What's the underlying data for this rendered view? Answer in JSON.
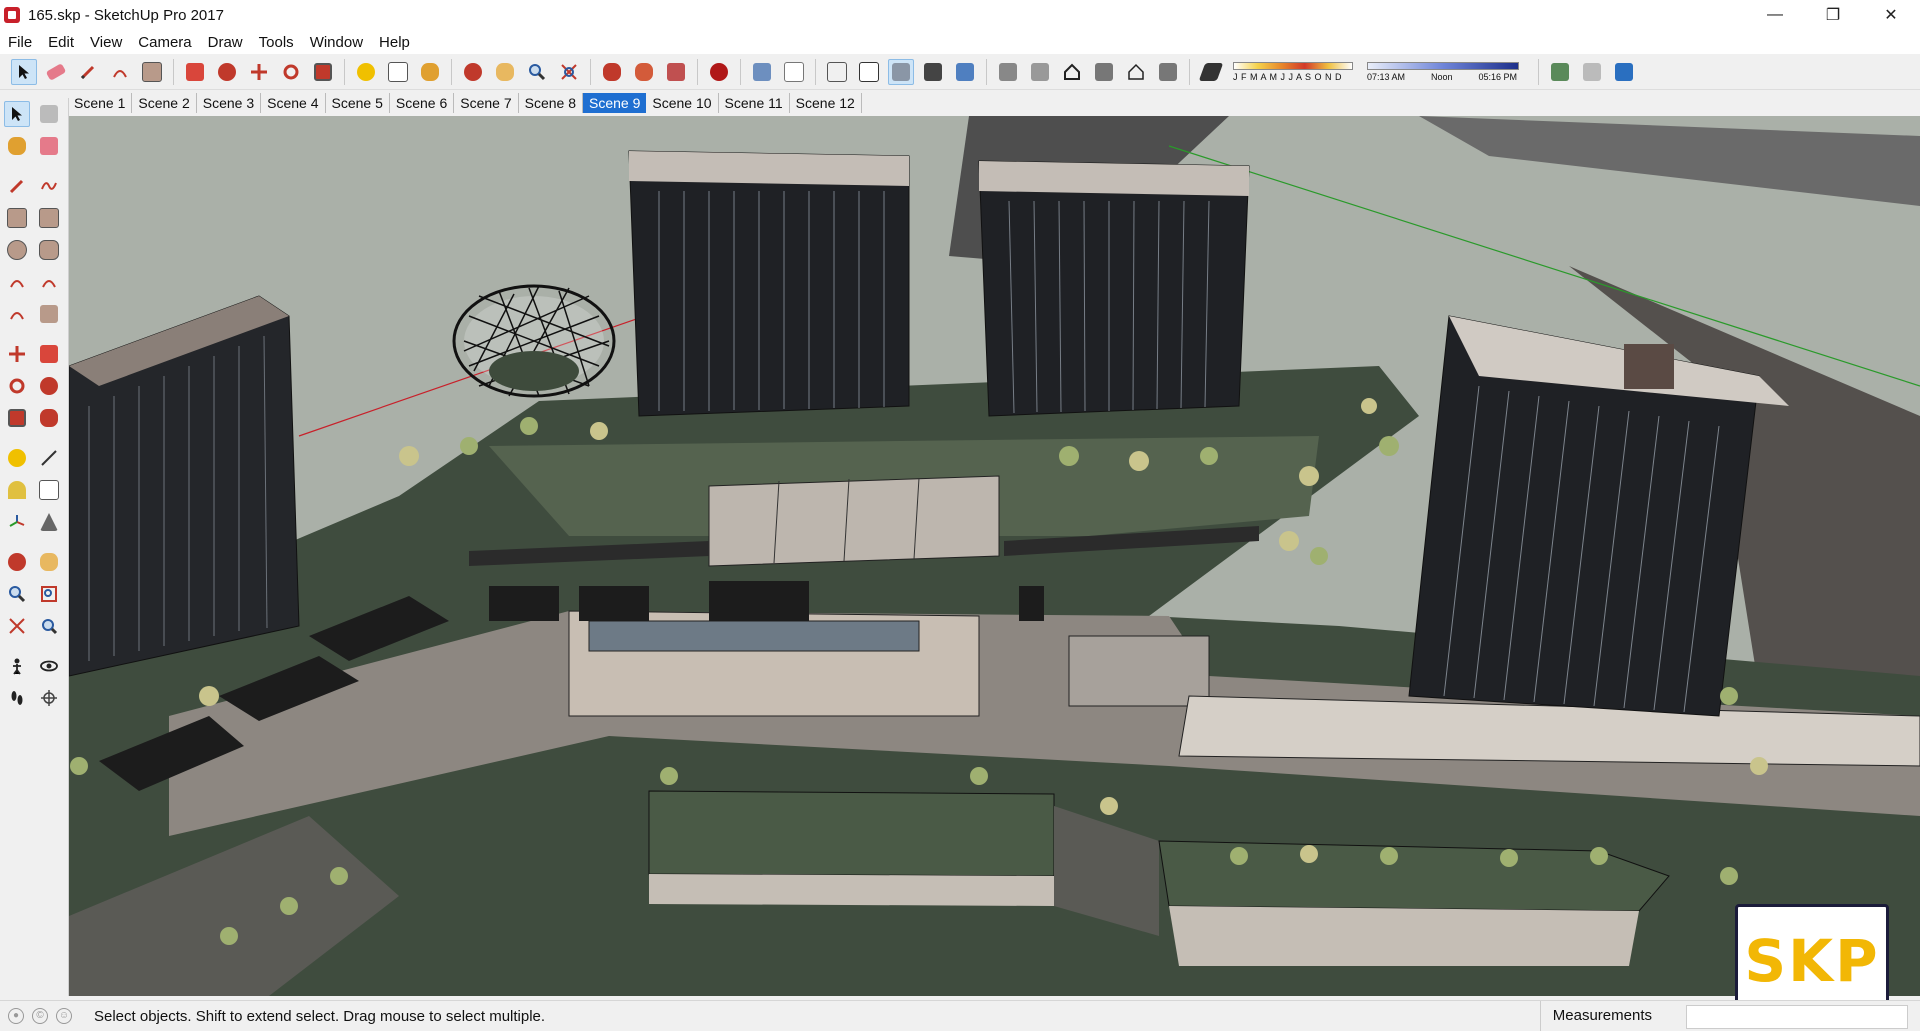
{
  "window": {
    "title": "165.skp - SketchUp Pro 2017",
    "minimize": "—",
    "maximize": "❐",
    "close": "✕"
  },
  "menu": [
    "File",
    "Edit",
    "View",
    "Camera",
    "Draw",
    "Tools",
    "Window",
    "Help"
  ],
  "shadows": {
    "months": "J F M A M J J A S O N D",
    "time_start": "07:13 AM",
    "time_mid": "Noon",
    "time_end": "05:16 PM"
  },
  "scenes": [
    "Scene 1",
    "Scene 2",
    "Scene 3",
    "Scene 4",
    "Scene 5",
    "Scene 6",
    "Scene 7",
    "Scene 8",
    "Scene 9",
    "Scene 10",
    "Scene 11",
    "Scene 12"
  ],
  "active_scene": "Scene 9",
  "status": {
    "message": "Select objects. Shift to extend select. Drag mouse to select multiple.",
    "measurements_label": "Measurements",
    "measurements_value": ""
  },
  "logo": {
    "text": "SKP"
  },
  "colors": {
    "ground": "#4d5a4c",
    "roof": "#3c4a3a",
    "building_dark": "#1b1d20",
    "accent_blue": "#1f6fd1",
    "logo_yellow": "#f2b705"
  }
}
